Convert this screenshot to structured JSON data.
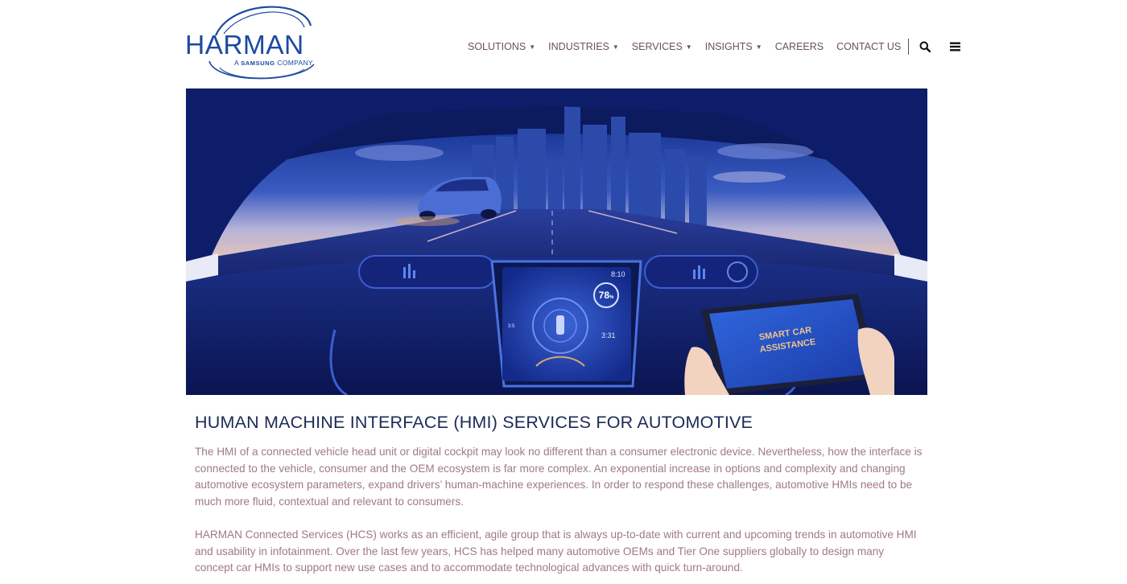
{
  "brand": {
    "name": "HARMAN",
    "tagline_prefix": "A",
    "tagline_brand": "SAMSUNG",
    "tagline_suffix": "COMPANY",
    "color": "#1d4aa0"
  },
  "nav": {
    "items": [
      {
        "label": "SOLUTIONS",
        "has_dropdown": true
      },
      {
        "label": "INDUSTRIES",
        "has_dropdown": true
      },
      {
        "label": "SERVICES",
        "has_dropdown": true
      },
      {
        "label": "INSIGHTS",
        "has_dropdown": true
      },
      {
        "label": "CAREERS",
        "has_dropdown": false
      },
      {
        "label": "CONTACT US",
        "has_dropdown": false
      }
    ],
    "icons": [
      "search-icon",
      "menu-icon"
    ],
    "text_color": "#6d5058"
  },
  "hero": {
    "dash_time_top": "8:10",
    "dash_speed": "78",
    "dash_speed_unit": "%",
    "dash_time_bottom": "3:31",
    "dash_side_label": "3:5",
    "tablet_line1": "SMART CAR",
    "tablet_line2": "ASSISTANCE"
  },
  "content": {
    "title": "HUMAN MACHINE INTERFACE (HMI) SERVICES FOR AUTOMOTIVE",
    "paragraph1": "The HMI of a connected vehicle head unit or digital cockpit may look no different than a consumer electronic device. Nevertheless, how the interface is connected to the vehicle, consumer and the OEM ecosystem is far more complex. An exponential increase in options and complexity and changing automotive ecosystem parameters, expand drivers’ human-machine experiences. In order to respond these challenges, automotive HMIs need to be much more fluid, contextual and relevant to consumers.",
    "paragraph2": "HARMAN Connected Services (HCS) works as an efficient, agile group that is always up-to-date with current and upcoming trends in automotive HMI and usability in infotainment. Over the last few years, HCS has helped many automotive OEMs and Tier One suppliers globally to design many concept car HMIs to support new use cases and to accommodate technological advances with quick turn-around."
  }
}
